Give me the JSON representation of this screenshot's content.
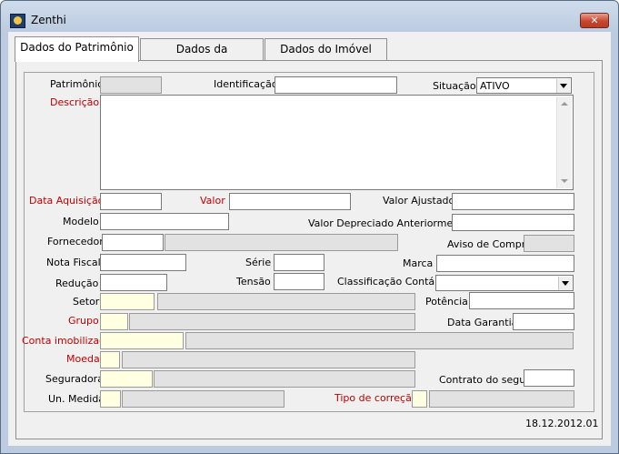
{
  "window": {
    "title": "Zenthi"
  },
  "tabs": [
    {
      "label": "Dados do Patrimônio"
    },
    {
      "label": "Dados da Depreciação"
    },
    {
      "label": "Dados do Imóvel"
    }
  ],
  "labels": {
    "patrimonio": "Patrimônio",
    "identificacao": "Identificação",
    "situacao": "Situação",
    "descricao": "Descrição",
    "data_aquisicao": "Data Aquisição",
    "valor": "Valor",
    "valor_ajustado": "Valor Ajustado",
    "modelo": "Modelo",
    "valor_depreciado": "Valor Depreciado Anteriormente",
    "fornecedor": "Fornecedor",
    "aviso_compra": "Aviso de Compra",
    "nota_fiscal": "Nota Fiscal",
    "serie": "Série",
    "marca": "Marca",
    "reducao": "Redução",
    "tensao": "Tensão",
    "classificacao_contabil": "Classificação Contábil",
    "setor": "Setor",
    "potencia": "Potência",
    "grupo": "Grupo",
    "data_garantia": "Data Garantia",
    "conta_imobilizado": "Conta imobilizado",
    "moeda": "Moeda",
    "seguradora": "Seguradora",
    "contrato_seguro": "Contrato do seguro",
    "un_medida": "Un. Medida",
    "tipo_correcao": "Tipo de correção"
  },
  "fields": {
    "situacao_value": "ATIVO"
  },
  "colors": {
    "required_label": "#c00000",
    "lookup_field": "#ffffe1",
    "readonly_field": "#e2e2e2"
  },
  "status": {
    "version": "18.12.2012.01"
  }
}
